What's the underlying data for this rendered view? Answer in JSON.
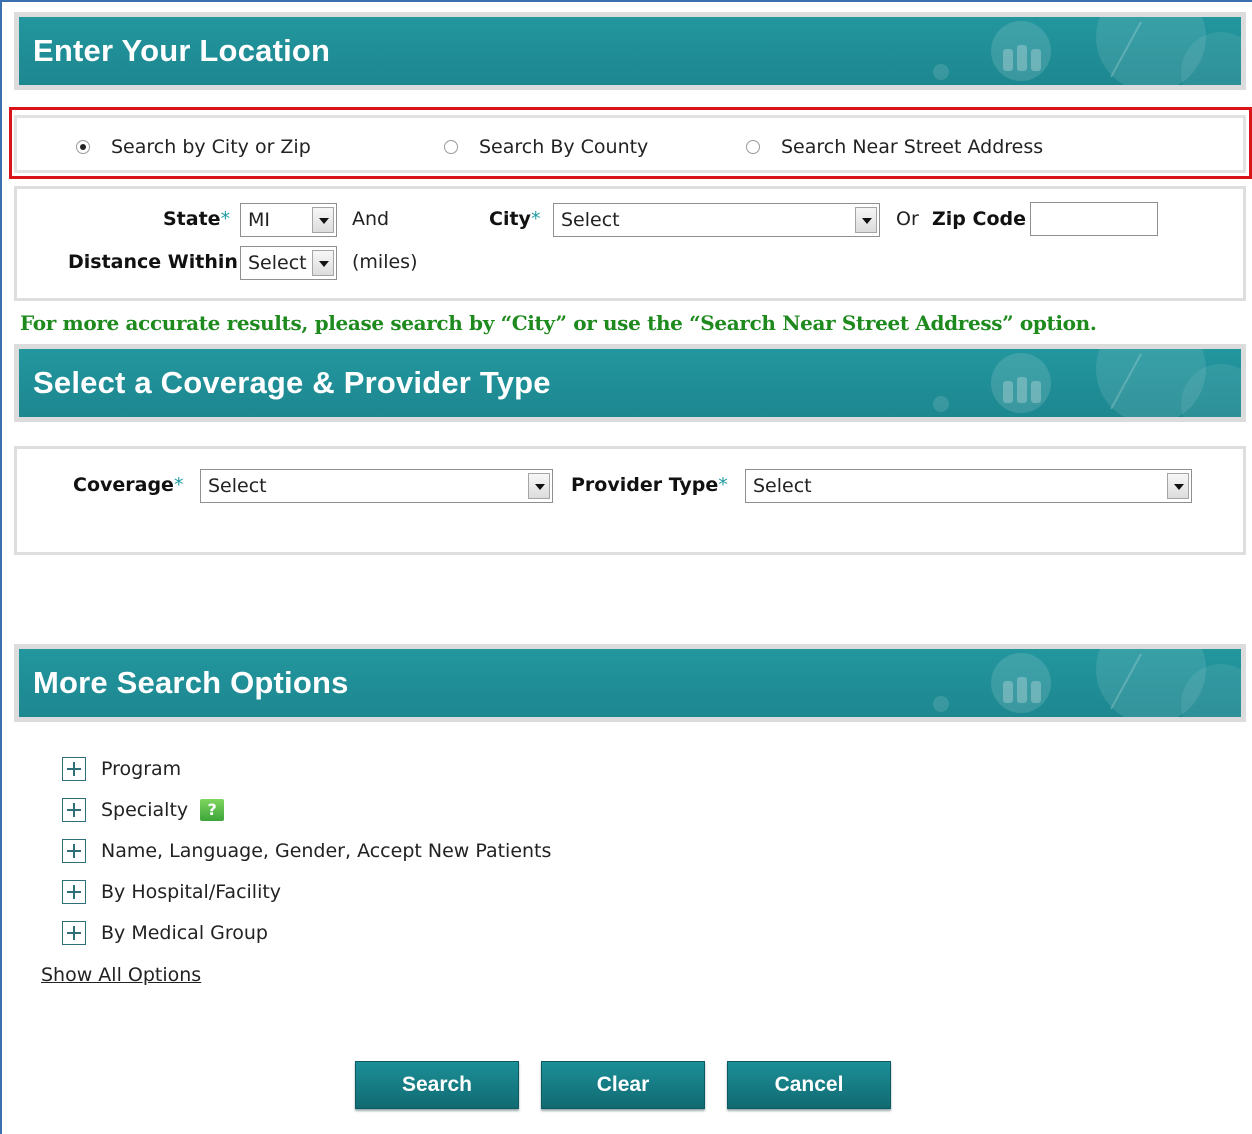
{
  "sections": {
    "location": "Enter Your Location",
    "coverage": "Select a Coverage & Provider Type",
    "more": "More Search Options"
  },
  "search_mode": {
    "options": [
      "Search by City or Zip",
      "Search By County",
      "Search Near Street Address"
    ],
    "selected": "Search by City or Zip"
  },
  "location_form": {
    "state_label": "State",
    "state_value": "MI",
    "and_text": "And",
    "city_label": "City",
    "city_value": "Select",
    "or_text": "Or",
    "zip_label": "Zip Code",
    "zip_value": "",
    "distance_label": "Distance Within",
    "distance_value": "Select",
    "miles_text": "(miles)",
    "required_mark": "*"
  },
  "note": "For more accurate results, please search by “City” or use the “Search Near Street Address” option.",
  "coverage_form": {
    "coverage_label": "Coverage",
    "coverage_value": "Select",
    "provider_label": "Provider Type",
    "provider_value": "Select"
  },
  "more_options": {
    "items": [
      "Program",
      "Specialty",
      "Name, Language, Gender, Accept New Patients",
      "By Hospital/Facility",
      "By Medical Group"
    ],
    "help_glyph": "?",
    "show_all": "Show All Options"
  },
  "buttons": {
    "search": "Search",
    "clear": "Clear",
    "cancel": "Cancel"
  },
  "colors": {
    "banner": "#1f8f98",
    "highlight_border": "#d9141b",
    "note": "#1e8a1e",
    "required": "#1f9aa3"
  }
}
